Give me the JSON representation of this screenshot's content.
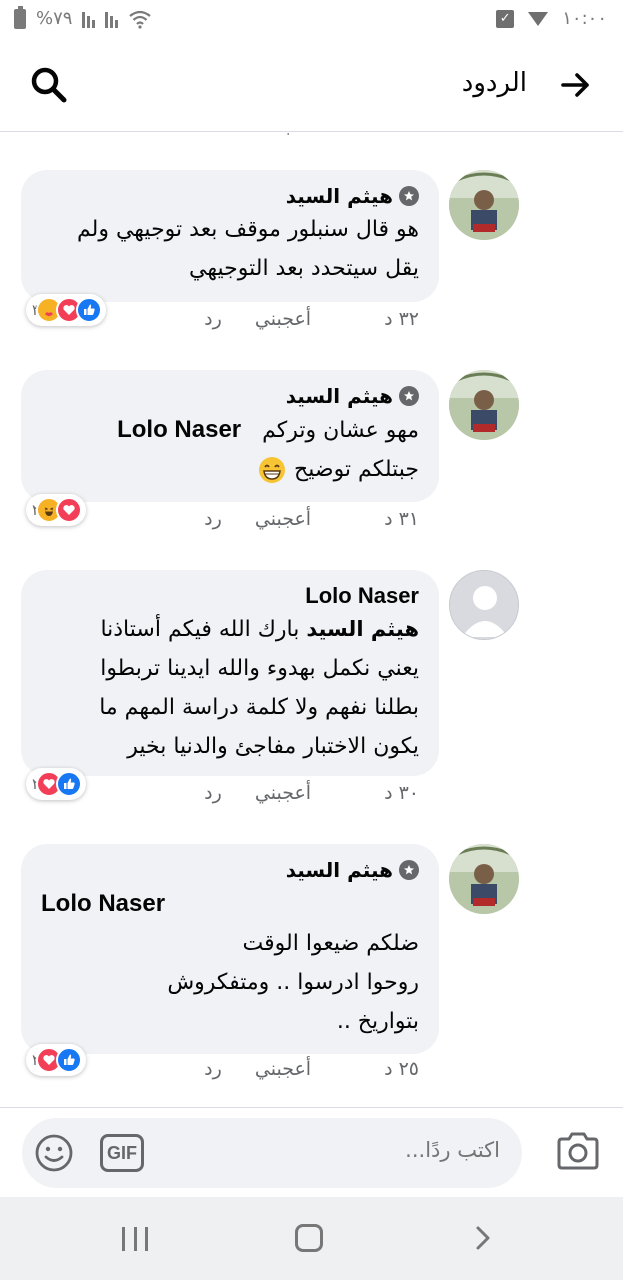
{
  "status_bar": {
    "battery_text": "%٧٩",
    "time": "١٠:٠٠",
    "icons": [
      "battery-icon",
      "signal-icon",
      "signal-icon",
      "wifi-icon",
      "notification-check-icon",
      "download-icon"
    ]
  },
  "header": {
    "title": "الردود",
    "back_icon": "arrow-right-icon",
    "search_icon": "search-icon"
  },
  "stray_char": "'",
  "comments": [
    {
      "author": "هيثم السيد",
      "badge": "shield-star-icon",
      "lines": [
        "هو قال سنبلور موقف بعد توجيهي ولم",
        "يقل سيتحدد بعد التوجيهي"
      ],
      "time": "٣٢ د",
      "like_label": "أعجبني",
      "reply_label": "رد",
      "reactions": [
        "like",
        "love",
        "care"
      ],
      "reaction_count": "٣"
    },
    {
      "author": "هيثم السيد",
      "badge": "shield-star-icon",
      "mention": "Lolo Naser",
      "line1": "مهو عشان وتركم",
      "line2": "جبتلكم توضيح",
      "emoji": "grinning-emoji",
      "time": "٣١ د",
      "like_label": "أعجبني",
      "reply_label": "رد",
      "reactions": [
        "love",
        "haha"
      ],
      "reaction_count": "٢"
    },
    {
      "author": "Lolo Naser",
      "mention": "هيثم السيد",
      "line1": "بارك الله فيكم أستاذنا",
      "lines": [
        "يعني نكمل بهدوء والله ايدينا تربطوا",
        "بطلنا نفهم ولا كلمة دراسة  المهم ما",
        "يكون الاختبار مفاجئ والدنيا بخير"
      ],
      "time": "٣٠ د",
      "like_label": "أعجبني",
      "reply_label": "رد",
      "reactions": [
        "like",
        "love"
      ],
      "reaction_count": "٢"
    },
    {
      "author": "هيثم السيد",
      "badge": "shield-star-icon",
      "mention": "Lolo Naser",
      "lines": [
        "ضلكم ضيعوا الوقت",
        "روحوا  ادرسوا .. ومتفكروش",
        "بتواريخ .."
      ],
      "time": "٢٥ د",
      "like_label": "أعجبني",
      "reply_label": "رد",
      "reactions": [
        "like",
        "love"
      ],
      "reaction_count": "٢"
    }
  ],
  "composer": {
    "placeholder": "اكتب ردًا...",
    "gif_label": "GIF",
    "icons": [
      "emoji-icon",
      "gif-icon",
      "camera-icon"
    ]
  },
  "nav": {
    "icons": [
      "recent-apps-icon",
      "home-icon",
      "back-icon"
    ]
  },
  "colors": {
    "bubble": "#f0f2f5",
    "like": "#1877f2",
    "love": "#f33e58",
    "haha": "#f7b125",
    "meta_text": "#65676b"
  }
}
